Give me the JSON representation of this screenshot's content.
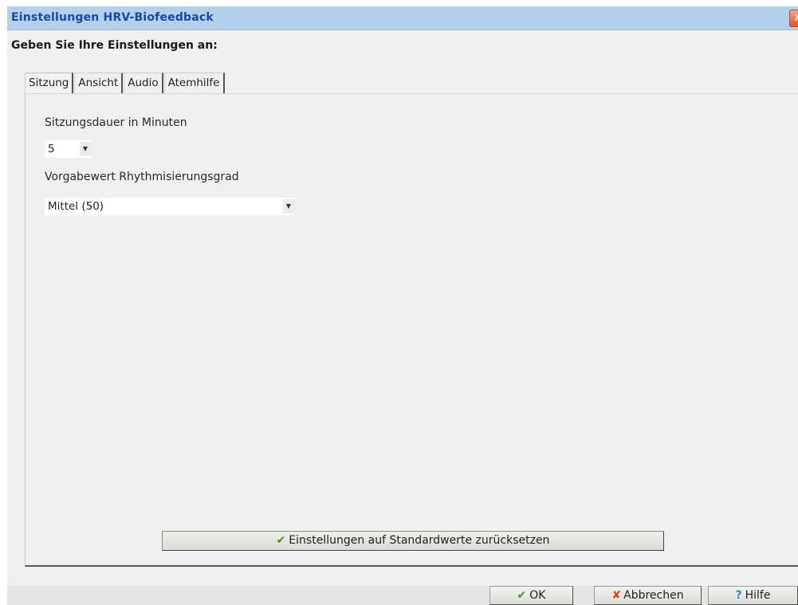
{
  "window": {
    "title": "Einstellungen HRV-Biofeedback",
    "close_glyph": "✕"
  },
  "header": {
    "subtitle": "Geben Sie Ihre Einstellungen an:"
  },
  "tabs": [
    {
      "label": "Sitzung",
      "active": true
    },
    {
      "label": "Ansicht",
      "active": false
    },
    {
      "label": "Audio",
      "active": false
    },
    {
      "label": "Atemhilfe",
      "active": false
    }
  ],
  "session": {
    "duration_label": "Sitzungsdauer in Minuten",
    "duration_value": "5",
    "rhythm_label": "Vorgabewert Rhythmisierungsgrad",
    "rhythm_value": "Mittel (50)",
    "dropdown_glyph": "▼"
  },
  "reset_button": {
    "icon": "checkmark-icon",
    "glyph": "✔",
    "label": "Einstellungen auf Standardwerte zurücksetzen"
  },
  "footer": {
    "ok": {
      "icon": "checkmark-icon",
      "glyph": "✔",
      "label": "OK"
    },
    "cancel": {
      "icon": "cross-icon",
      "glyph": "✘",
      "label": "Abbrechen"
    },
    "help": {
      "icon": "question-icon",
      "glyph": "?",
      "label": "Hilfe"
    }
  },
  "colors": {
    "titlebar": "#b3d0ea",
    "title_text": "#1e47a6",
    "check_green": "#3d9b1d",
    "cancel_red": "#d64513",
    "help_blue": "#1f8fd6"
  }
}
